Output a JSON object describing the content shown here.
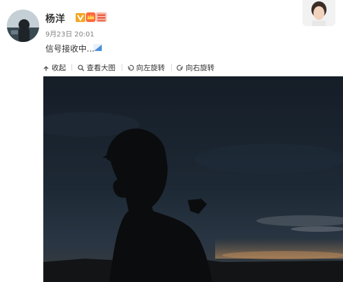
{
  "post": {
    "author": "杨洋",
    "timestamp": "9月23日 20:01",
    "text": "信号接收中..."
  },
  "toolbar": {
    "collapse": "收起",
    "view_large": "查看大图",
    "rotate_left": "向左旋转",
    "rotate_right": "向右旋转"
  },
  "colors": {
    "verified_badge": "#f5a623",
    "text": "#333333",
    "muted": "#808080",
    "photo_sky": "#1a2430"
  },
  "icons": {
    "verified": "verified-v-icon",
    "crown": "crown-badge-icon",
    "vip": "vip-badge-icon",
    "signal": "signal-icon",
    "collapse": "collapse-arrow-icon",
    "view": "magnifier-icon",
    "rotate_left": "rotate-left-icon",
    "rotate_right": "rotate-right-icon"
  }
}
